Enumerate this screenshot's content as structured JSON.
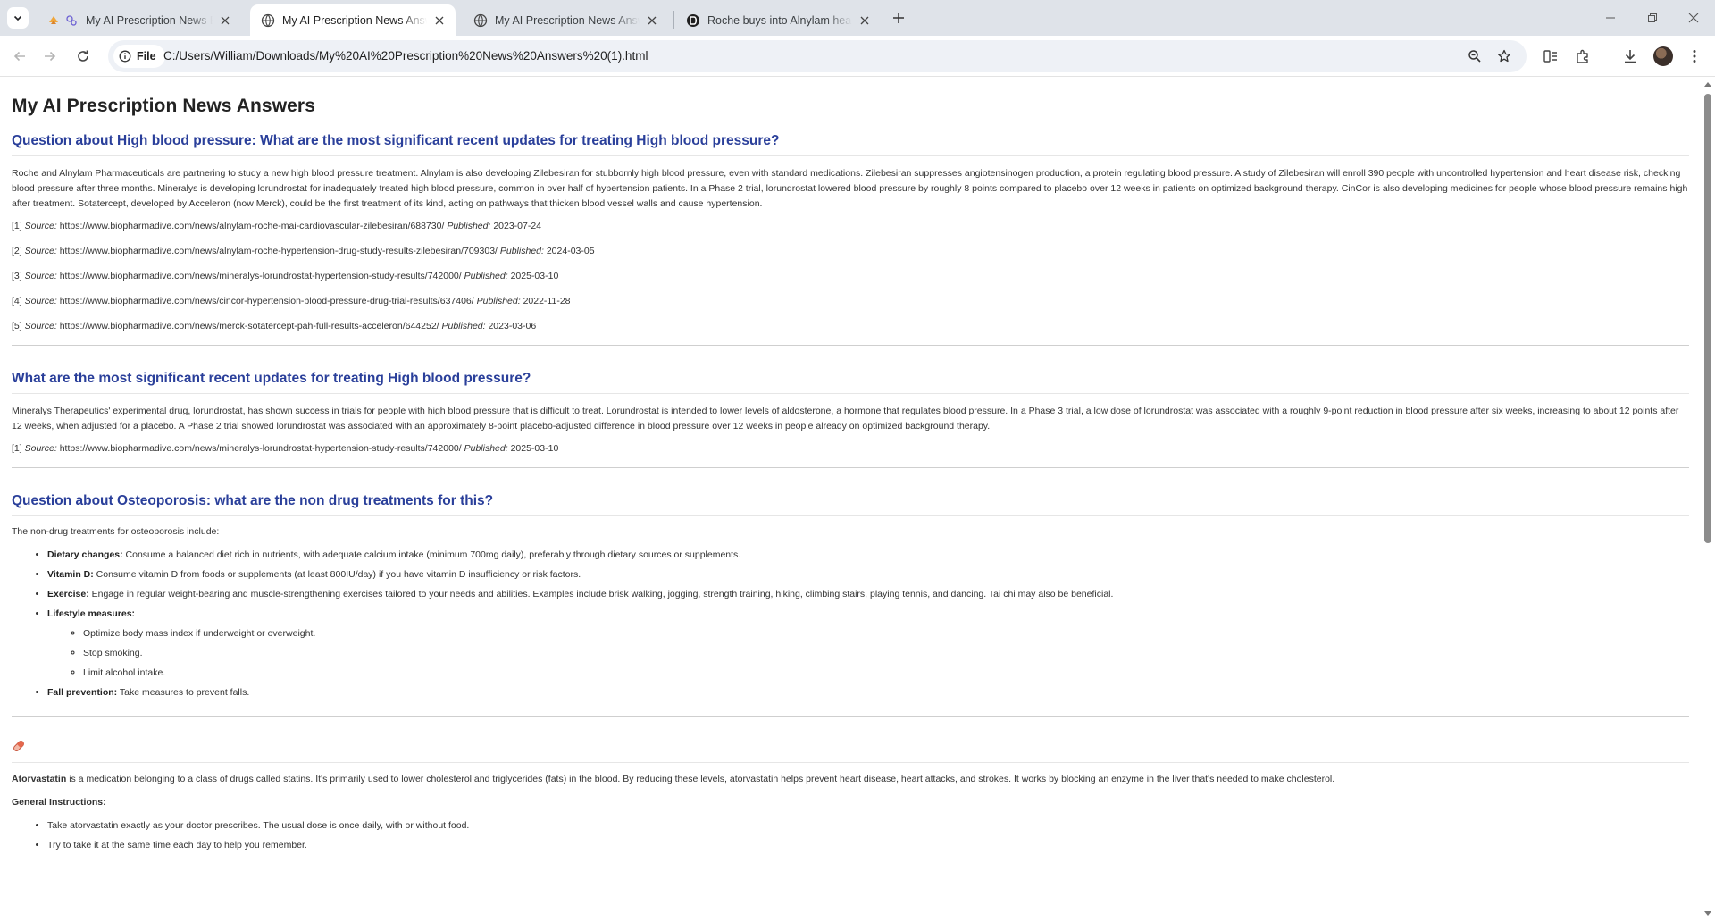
{
  "browser": {
    "tabs": [
      {
        "title": "My AI Prescription News Bot",
        "active": false,
        "favicon": "ai-bot-icon"
      },
      {
        "title": "My AI Prescription News Answers",
        "active": true,
        "favicon": "globe-icon"
      },
      {
        "title": "My AI Prescription News Answers",
        "active": false,
        "favicon": "globe-icon"
      },
      {
        "title": "Roche buys into Alnylam heart",
        "active": false,
        "favicon": "biopharma-dive-icon"
      }
    ],
    "chip_label": "File",
    "url": "C:/Users/William/Downloads/My%20AI%20Prescription%20News%20Answers%20(1).html"
  },
  "page": {
    "title": "My AI Prescription News Answers",
    "sections": [
      {
        "heading": "Question about High blood pressure: What are the most significant recent updates for treating High blood pressure?",
        "answer": "Roche and Alnylam Pharmaceuticals are partnering to study a new high blood pressure treatment. Alnylam is also developing Zilebesiran for stubbornly high blood pressure, even with standard medications. Zilebesiran suppresses angiotensinogen production, a protein regulating blood pressure. A study of Zilebesiran will enroll 390 people with uncontrolled hypertension and heart disease risk, checking blood pressure after three months. Mineralys is developing lorundrostat for inadequately treated high blood pressure, common in over half of hypertension patients. In a Phase 2 trial, lorundrostat lowered blood pressure by roughly 8 points compared to placebo over 12 weeks in patients on optimized background therapy. CinCor is also developing medicines for people whose blood pressure remains high after treatment. Sotatercept, developed by Acceleron (now Merck), could be the first treatment of its kind, acting on pathways that thicken blood vessel walls and cause hypertension.",
        "sources": [
          {
            "num": "[1]",
            "url": "https://www.biopharmadive.com/news/alnylam-roche-mai-cardiovascular-zilebesiran/688730/",
            "date": "2023-07-24"
          },
          {
            "num": "[2]",
            "url": "https://www.biopharmadive.com/news/alnylam-roche-hypertension-drug-study-results-zilebesiran/709303/",
            "date": "2024-03-05"
          },
          {
            "num": "[3]",
            "url": "https://www.biopharmadive.com/news/mineralys-lorundrostat-hypertension-study-results/742000/",
            "date": "2025-03-10"
          },
          {
            "num": "[4]",
            "url": "https://www.biopharmadive.com/news/cincor-hypertension-blood-pressure-drug-trial-results/637406/",
            "date": "2022-11-28"
          },
          {
            "num": "[5]",
            "url": "https://www.biopharmadive.com/news/merck-sotatercept-pah-full-results-acceleron/644252/",
            "date": "2023-03-06"
          }
        ]
      },
      {
        "heading": "What are the most significant recent updates for treating High blood pressure?",
        "answer": "Mineralys Therapeutics' experimental drug, lorundrostat, has shown success in trials for people with high blood pressure that is difficult to treat. Lorundrostat is intended to lower levels of aldosterone, a hormone that regulates blood pressure. In a Phase 3 trial, a low dose of lorundrostat was associated with a roughly 9-point reduction in blood pressure after six weeks, increasing to about 12 points after 12 weeks, when adjusted for a placebo. A Phase 2 trial showed lorundrostat was associated with an approximately 8-point placebo-adjusted difference in blood pressure over 12 weeks in people already on optimized background therapy.",
        "sources": [
          {
            "num": "[1]",
            "url": "https://www.biopharmadive.com/news/mineralys-lorundrostat-hypertension-study-results/742000/",
            "date": "2025-03-10"
          }
        ]
      }
    ],
    "source_label": "Source:",
    "published_label": "Published:",
    "osteo": {
      "heading": "Question about Osteoporosis: what are the non drug treatments for this?",
      "intro": "The non-drug treatments for osteoporosis include:",
      "items": [
        {
          "label": "Dietary changes:",
          "text": "Consume a balanced diet rich in nutrients, with adequate calcium intake (minimum 700mg daily), preferably through dietary sources or supplements."
        },
        {
          "label": "Vitamin D:",
          "text": "Consume vitamin D from foods or supplements (at least 800IU/day) if you have vitamin D insufficiency or risk factors."
        },
        {
          "label": "Exercise:",
          "text": "Engage in regular weight-bearing and muscle-strengthening exercises tailored to your needs and abilities. Examples include brisk walking, jogging, strength training, hiking, climbing stairs, playing tennis, and dancing. Tai chi may also be beneficial."
        },
        {
          "label": "Lifestyle measures:",
          "text": ""
        },
        {
          "label": "Fall prevention:",
          "text": "Take measures to prevent falls."
        }
      ],
      "lifestyle_sub": [
        "Optimize body mass index if underweight or overweight.",
        "Stop smoking.",
        "Limit alcohol intake."
      ]
    },
    "atorva": {
      "icon": "pill-icon",
      "name": "Atorvastatin",
      "description": "is a medication belonging to a class of drugs called statins. It's primarily used to lower cholesterol and triglycerides (fats) in the blood. By reducing these levels, atorvastatin helps prevent heart disease, heart attacks, and strokes. It works by blocking an enzyme in the liver that's needed to make cholesterol.",
      "general_heading": "General Instructions:",
      "instructions": [
        "Take atorvastatin exactly as your doctor prescribes. The usual dose is once daily, with or without food.",
        "Try to take it at the same time each day to help you remember."
      ]
    }
  }
}
